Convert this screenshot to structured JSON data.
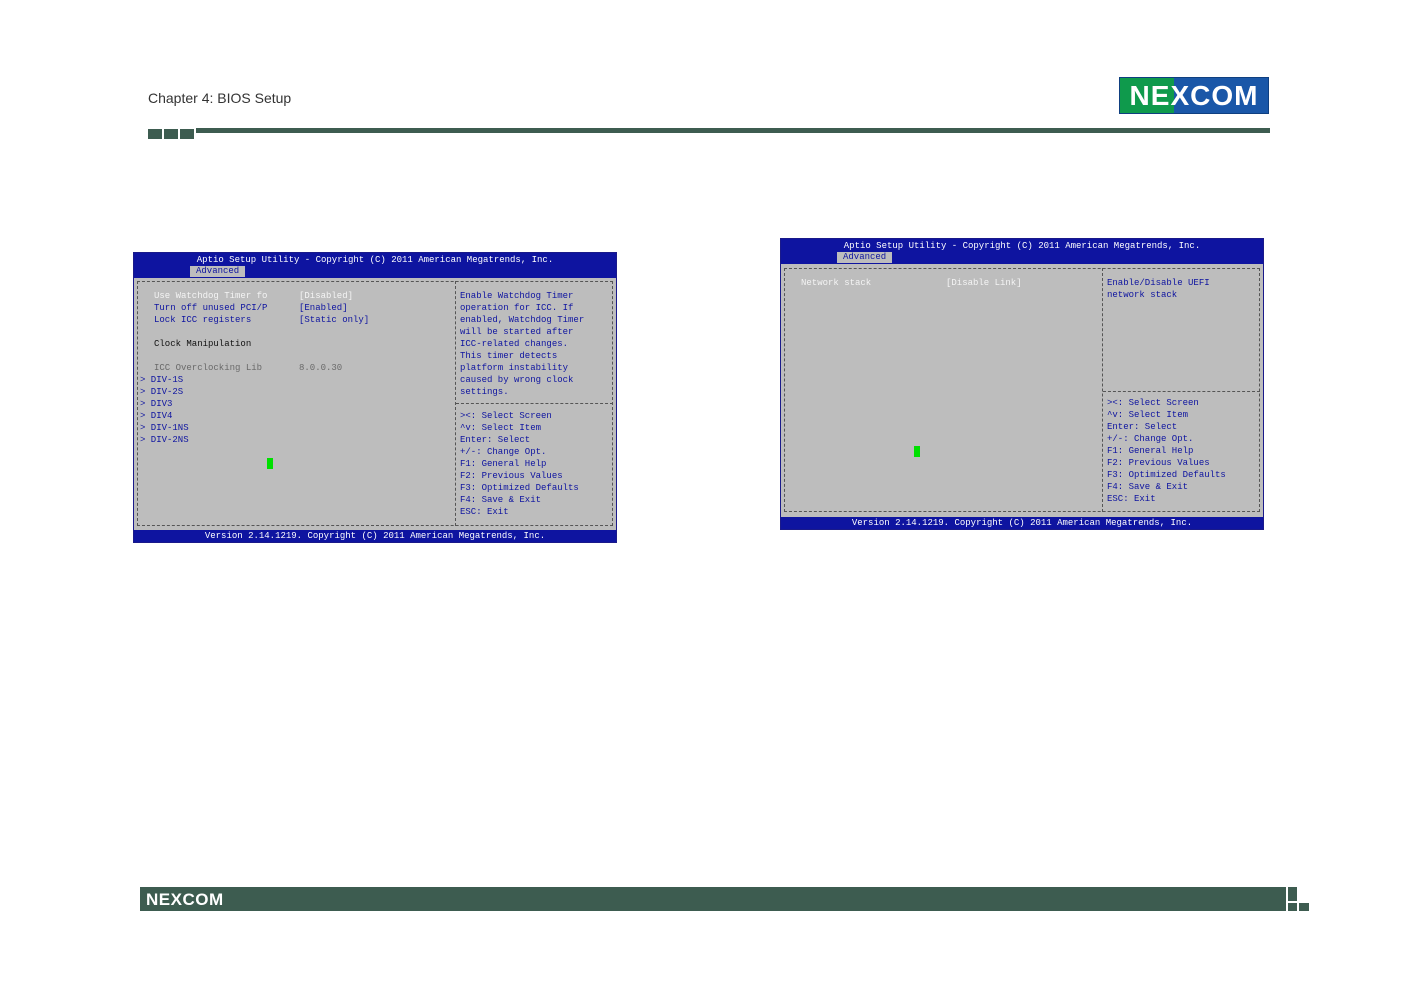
{
  "header": {
    "chapter": "Chapter 4: BIOS Setup",
    "logo": "NEXCOM"
  },
  "bios1": {
    "title": "Aptio Setup Utility - Copyright (C) 2011 American Megatrends, Inc.",
    "tab": "Advanced",
    "items": [
      {
        "label": "Use Watchdog Timer fo",
        "value": "[Disabled]"
      },
      {
        "label": "Turn off unused PCI/P",
        "value": "[Enabled]"
      },
      {
        "label": "Lock ICC registers",
        "value": "[Static only]"
      }
    ],
    "section": "Clock Manipulation",
    "icc_label": "ICC Overclocking Lib",
    "icc_value": "8.0.0.30",
    "submenus": [
      "> DIV-1S",
      "> DIV-2S",
      "> DIV3",
      "> DIV4",
      "> DIV-1NS",
      "> DIV-2NS"
    ],
    "help": [
      "Enable Watchdog Timer",
      "operation for ICC. If",
      "enabled, Watchdog Timer",
      "will be started after",
      "ICC-related changes.",
      "This timer detects",
      "platform instability",
      "caused by wrong clock",
      "settings."
    ],
    "keys": [
      "><: Select Screen",
      "^v: Select Item",
      "Enter: Select",
      "+/-: Change Opt.",
      "F1: General Help",
      "F2: Previous Values",
      "F3: Optimized Defaults",
      "F4: Save & Exit",
      "ESC: Exit"
    ],
    "footer": "Version 2.14.1219. Copyright (C) 2011 American Megatrends, Inc."
  },
  "bios2": {
    "title": "Aptio Setup Utility - Copyright (C) 2011 American Megatrends, Inc.",
    "tab": "Advanced",
    "item": {
      "label": "Network stack",
      "value": "[Disable Link]"
    },
    "help": [
      "Enable/Disable UEFI",
      "network stack"
    ],
    "keys": [
      "><: Select Screen",
      "^v: Select Item",
      "Enter: Select",
      "+/-: Change Opt.",
      "F1: General Help",
      "F2: Previous Values",
      "F3: Optimized Defaults",
      "F4: Save & Exit",
      "ESC: Exit"
    ],
    "footer": "Version 2.14.1219. Copyright (C) 2011 American Megatrends, Inc."
  },
  "footer": {
    "logo": "NEXCOM"
  },
  "colors": {
    "bios_blue": "#0e14a0",
    "bios_gray": "#bdbdbd",
    "cursor_green": "#00e000",
    "brand_green_bar": "#3d5c50"
  }
}
